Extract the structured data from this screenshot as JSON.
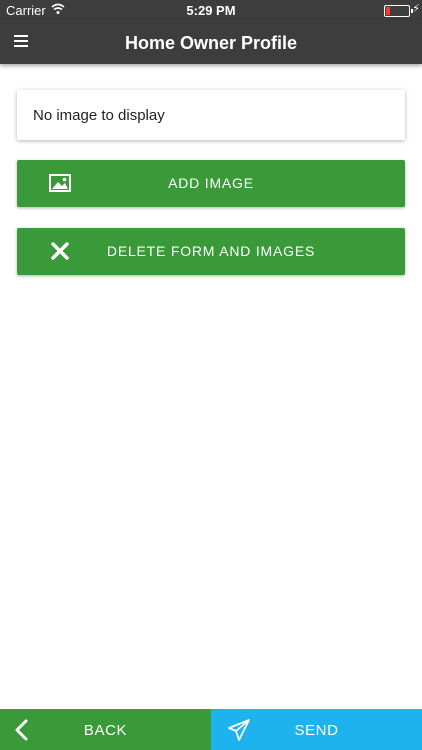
{
  "status_bar": {
    "carrier": "Carrier",
    "time": "5:29 PM"
  },
  "nav": {
    "title": "Home Owner Profile",
    "menu_icon": "hamburger-menu-icon"
  },
  "content": {
    "empty_message": "No image to display",
    "add_image": {
      "label": "ADD IMAGE",
      "icon": "image-icon"
    },
    "delete_all": {
      "label": "DELETE FORM AND IMAGES",
      "icon": "close-icon"
    }
  },
  "bottom_bar": {
    "back": {
      "label": "BACK",
      "icon": "chevron-left-icon"
    },
    "send": {
      "label": "SEND",
      "icon": "paper-plane-icon"
    }
  },
  "colors": {
    "header": "#3d3d3d",
    "primary_green": "#3a9a3a",
    "send_blue": "#1eb2ee"
  }
}
